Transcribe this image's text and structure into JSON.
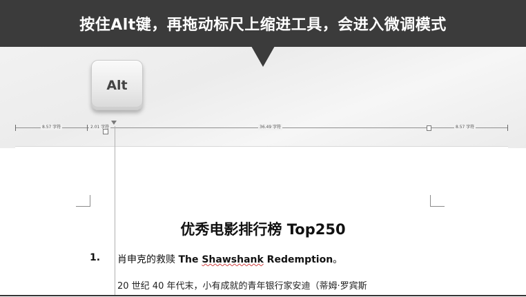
{
  "banner": {
    "text": "按住Alt键，再拖动标尺上缩进工具，会进入微调模式"
  },
  "key": {
    "label": "Alt"
  },
  "ruler": {
    "left_margin": "8.57 字符",
    "indent": "2.01 字符",
    "text_width": "36.49 字符",
    "right_margin": "8.57 字符"
  },
  "document": {
    "title": "优秀电影排行榜 Top250",
    "items": [
      {
        "number": "1.",
        "title_cn": "肖申克的救赎 ",
        "title_en_pre": "The ",
        "title_en_err": "Shawshank",
        "title_en_post": " Redemption",
        "title_end": "。",
        "body": "20 世纪 40 年代末，小有成就的青年银行家安迪（蒂姆·罗宾斯"
      }
    ]
  }
}
